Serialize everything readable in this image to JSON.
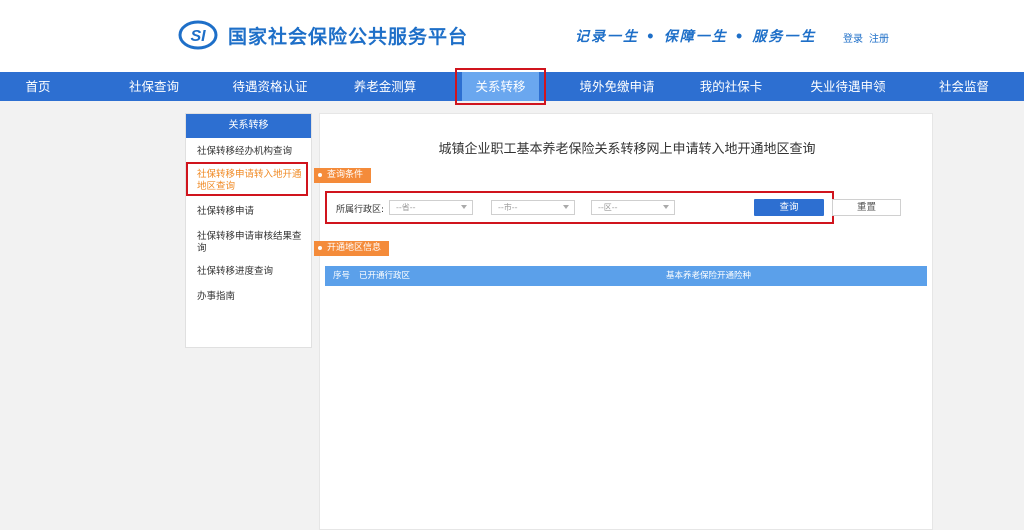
{
  "header": {
    "logo_text": "SI",
    "title": "国家社会保险公共服务平台",
    "slogan": "记录一生 • 保障一生 • 服务一生",
    "login": "登录",
    "register": "注册"
  },
  "nav": {
    "items": [
      {
        "label": "首页"
      },
      {
        "label": "社保查询"
      },
      {
        "label": "待遇资格认证"
      },
      {
        "label": "养老金测算"
      },
      {
        "label": "关系转移"
      },
      {
        "label": "境外免缴申请"
      },
      {
        "label": "我的社保卡"
      },
      {
        "label": "失业待遇申领"
      },
      {
        "label": "社会监督"
      }
    ],
    "active_index": 4
  },
  "sidebar": {
    "title": "关系转移",
    "items": [
      {
        "label": "社保转移经办机构查询"
      },
      {
        "label": "社保转移申请转入地开通地区查询"
      },
      {
        "label": "社保转移申请"
      },
      {
        "label": "社保转移申请审核结果查询"
      },
      {
        "label": "社保转移进度查询"
      },
      {
        "label": "办事指南"
      }
    ],
    "active_index": 1
  },
  "main": {
    "title": "城镇企业职工基本养老保险关系转移网上申请转入地开通地区查询",
    "query_section_label": "查询条件",
    "region_label": "所属行政区:",
    "province_placeholder": "--省--",
    "city_placeholder": "--市--",
    "district_placeholder": "--区--",
    "query_button": "查询",
    "reset_button": "重置",
    "result_section_label": "开通地区信息",
    "table_columns": [
      "序号",
      "已开通行政区",
      "基本养老保险开通险种"
    ]
  },
  "colors": {
    "brand_blue": "#2d6fd1",
    "nav_active": "#6aa7ef",
    "highlight_red": "#d0141d",
    "tag_orange": "#f48b3a",
    "table_header": "#5ba0ea"
  }
}
